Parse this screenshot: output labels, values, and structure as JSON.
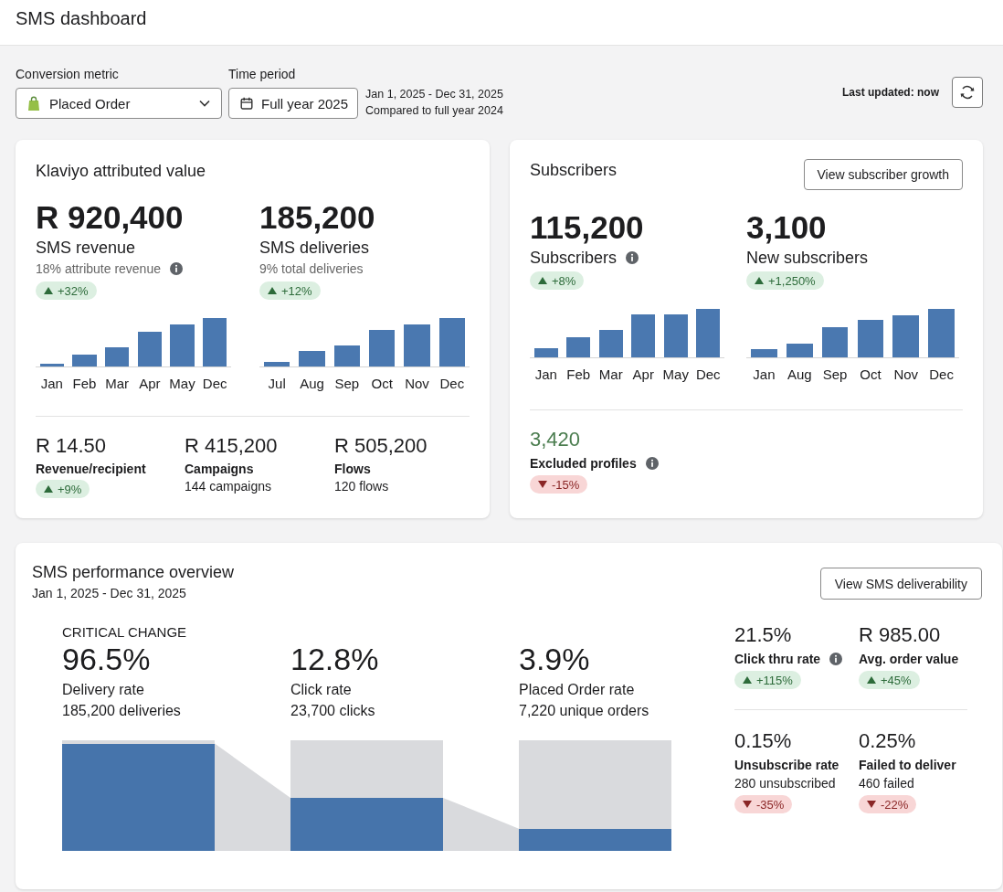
{
  "header": {
    "title": "SMS dashboard"
  },
  "filters": {
    "conversion_metric": {
      "label": "Conversion metric",
      "value": "Placed Order"
    },
    "time_period": {
      "label": "Time period",
      "value": "Full year 2025"
    },
    "date_range": "Jan 1, 2025 - Dec 31, 2025",
    "comparison": "Compared to full year 2024",
    "last_updated": "Last updated: now"
  },
  "attributed_value": {
    "title": "Klaviyo attributed value",
    "metrics": [
      {
        "value": "R 920,400",
        "label": "SMS revenue",
        "note": "18% attribute revenue",
        "info": true,
        "change": {
          "text": "+32%",
          "kind": "up"
        },
        "bar_labels": [
          "Jan",
          "Feb",
          "Mar",
          "Apr",
          "May",
          "Dec"
        ]
      },
      {
        "value": "185,200",
        "label": "SMS deliveries",
        "note": "9% total deliveries",
        "info": false,
        "change": {
          "text": "+12%",
          "kind": "up"
        },
        "bar_labels": [
          "Jul",
          "Aug",
          "Sep",
          "Oct",
          "Nov",
          "Dec"
        ]
      }
    ],
    "breakdown": [
      {
        "value": "R 14.50",
        "label": "Revenue/recipient",
        "change": {
          "text": "+9%",
          "kind": "up"
        }
      },
      {
        "value": "R 415,200",
        "label": "Campaigns",
        "note": "144 campaigns"
      },
      {
        "value": "R 505,200",
        "label": "Flows",
        "note": "120 flows"
      }
    ]
  },
  "subscribers": {
    "title": "Subscribers",
    "button": "View subscriber growth",
    "metrics": [
      {
        "value": "115,200",
        "label": "Subscribers",
        "info": true,
        "change": {
          "text": "+8%",
          "kind": "up"
        },
        "bar_labels": [
          "Jan",
          "Feb",
          "Mar",
          "Apr",
          "May",
          "Dec"
        ]
      },
      {
        "value": "3,100",
        "label": "New subscribers",
        "info": false,
        "change": {
          "text": "+1,250%",
          "kind": "up"
        },
        "bar_labels": [
          "Jan",
          "Aug",
          "Sep",
          "Oct",
          "Nov",
          "Dec"
        ]
      }
    ],
    "excluded": {
      "value": "3,420",
      "label": "Excluded profiles",
      "info": true,
      "change": {
        "text": "-15%",
        "kind": "down"
      }
    }
  },
  "performance": {
    "title": "SMS performance overview",
    "date_range": "Jan 1, 2025 - Dec 31, 2025",
    "button": "View SMS deliverability",
    "stages": [
      {
        "tag": "CRITICAL CHANGE",
        "value": "96.5%",
        "label": "Delivery rate",
        "note": "185,200 deliveries"
      },
      {
        "value": "12.8%",
        "label": "Click rate",
        "note": "23,700 clicks"
      },
      {
        "value": "3.9%",
        "label": "Placed Order rate",
        "note": "7,220 unique orders"
      }
    ],
    "stat_rows": [
      {
        "stats": [
          {
            "value": "21.5%",
            "label": "Click thru rate",
            "info": true,
            "change": {
              "text": "+115%",
              "kind": "up"
            }
          },
          {
            "value": "R 985.00",
            "label": "Avg. order value",
            "info": false,
            "change": {
              "text": "+45%",
              "kind": "up"
            }
          }
        ]
      },
      {
        "stats": [
          {
            "value": "0.15%",
            "label": "Unsubscribe rate",
            "note": "280 unsubscribed",
            "info": false,
            "change": {
              "text": "-35%",
              "kind": "down"
            }
          },
          {
            "value": "0.25%",
            "label": "Failed to deliver",
            "note": "460 failed",
            "info": false,
            "change": {
              "text": "-22%",
              "kind": "down"
            }
          }
        ]
      }
    ]
  }
}
